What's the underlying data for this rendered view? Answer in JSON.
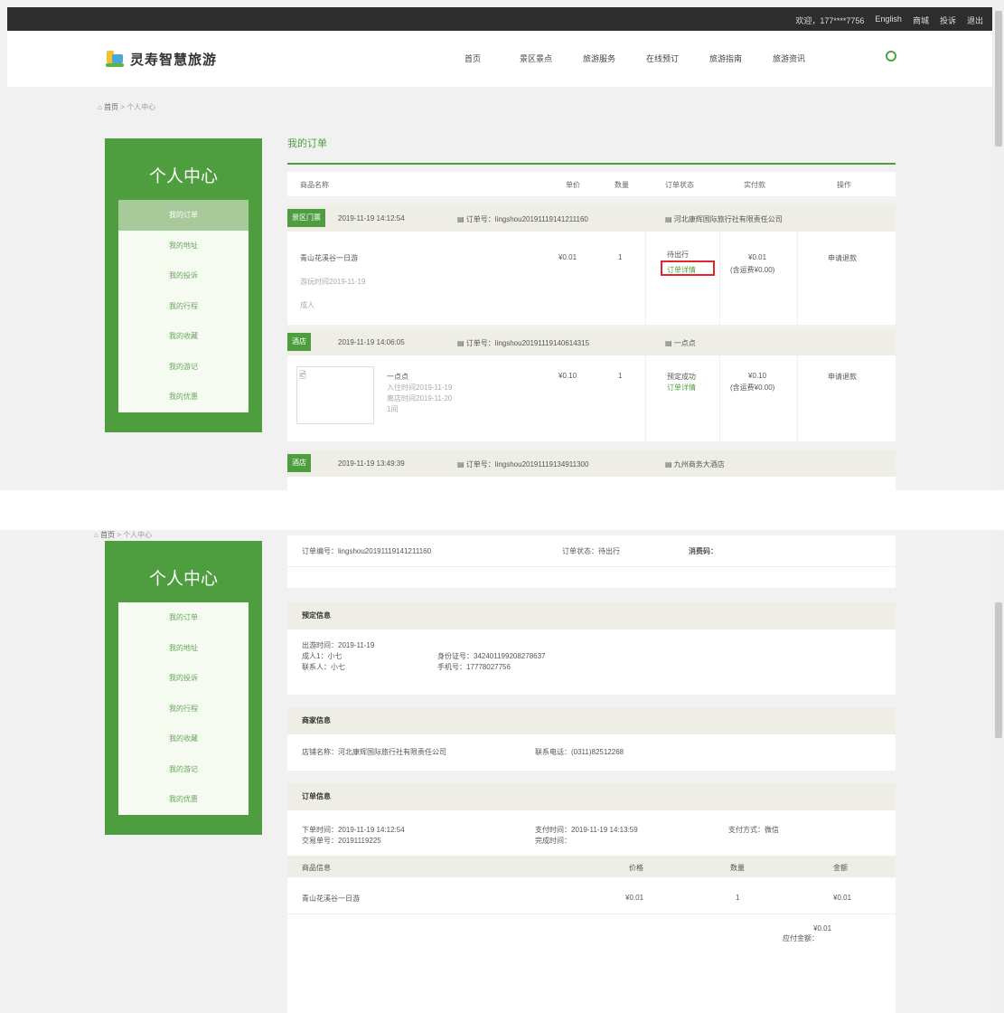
{
  "topbar": {
    "user": "欢迎，177****7756",
    "links": [
      "English",
      "商城",
      "投诉",
      "退出"
    ]
  },
  "logo": {
    "text": "灵寿智慧旅游"
  },
  "nav": [
    "首页",
    "景区景点",
    "旅游服务",
    "在线预订",
    "旅游指南",
    "旅游资讯"
  ],
  "breadcrumb": {
    "home": "首页",
    "current": "个人中心"
  },
  "sidebar": {
    "title": "个人中心",
    "items": [
      "我的订单",
      "我的地址",
      "我的投诉",
      "我的行程",
      "我的收藏",
      "我的游记",
      "我的优惠"
    ]
  },
  "orders_page": {
    "title": "我的订单",
    "columns": [
      "商品名称",
      "单价",
      "数量",
      "订单状态",
      "实付款",
      "操作"
    ],
    "orders": [
      {
        "tag": "景区门票",
        "time": "2019-11-19 14:12:54",
        "order_no": "订单号：lingshou20191119141211160",
        "shop": "河北康辉国际旅行社有限责任公司",
        "name": "青山花溪谷一日游",
        "date": "游玩时间2019-11-19",
        "extra": "成人",
        "price": "¥0.01",
        "qty": "1",
        "status": "待出行",
        "status_action": "订单详情",
        "paid": "¥0.01",
        "paid_note": "(含运费¥0.00)",
        "action": "申请退款"
      },
      {
        "tag": "酒店",
        "time": "2019-11-19 14:06:05",
        "order_no": "订单号：lingshou20191119140614315",
        "shop": "一点点",
        "name": "一点点",
        "date": "入住时间2019-11-19",
        "date2": "离店时间2019-11-20",
        "extra": "1间",
        "price": "¥0.10",
        "qty": "1",
        "status": "预定成功",
        "status_action": "订单详情",
        "paid": "¥0.10",
        "paid_note": "(含运费¥0.00)",
        "action": "申请退款"
      },
      {
        "tag": "酒店",
        "time": "2019-11-19 13:49:39",
        "order_no": "订单号：lingshou20191119134911300",
        "shop": "九州商务大酒店"
      }
    ]
  },
  "detail": {
    "order_no": "订单编号：lingshou20191119141211160",
    "order_status": "订单状态：待出行",
    "verify_code": "消费码：",
    "booking": {
      "title": "预定信息",
      "travel_date": "出游时间：2019-11-19",
      "adult": "成人1：小七",
      "id_card": "身份证号：342401199208278637",
      "contact": "联系人：小七",
      "phone": "手机号：17778027756"
    },
    "merchant": {
      "title": "商家信息",
      "name": "店铺名称：河北康辉国际旅行社有限责任公司",
      "tel": "联系电话：(0311)82512268"
    },
    "order_info": {
      "title": "订单信息",
      "created": "下单时间：2019-11-19 14:12:54",
      "trade_no": "交易单号：20191119225",
      "paid_time": "支付时间：2019-11-19 14:13:59",
      "done_time": "完成时间：",
      "pay_method": "支付方式：微信",
      "columns": [
        "商品信息",
        "价格",
        "数量",
        "金额"
      ],
      "item": {
        "name": "青山花溪谷一日游",
        "price": "¥0.01",
        "qty": "1",
        "amount": "¥0.01"
      },
      "total_label": "应付金额：",
      "total": "¥0.01"
    }
  }
}
